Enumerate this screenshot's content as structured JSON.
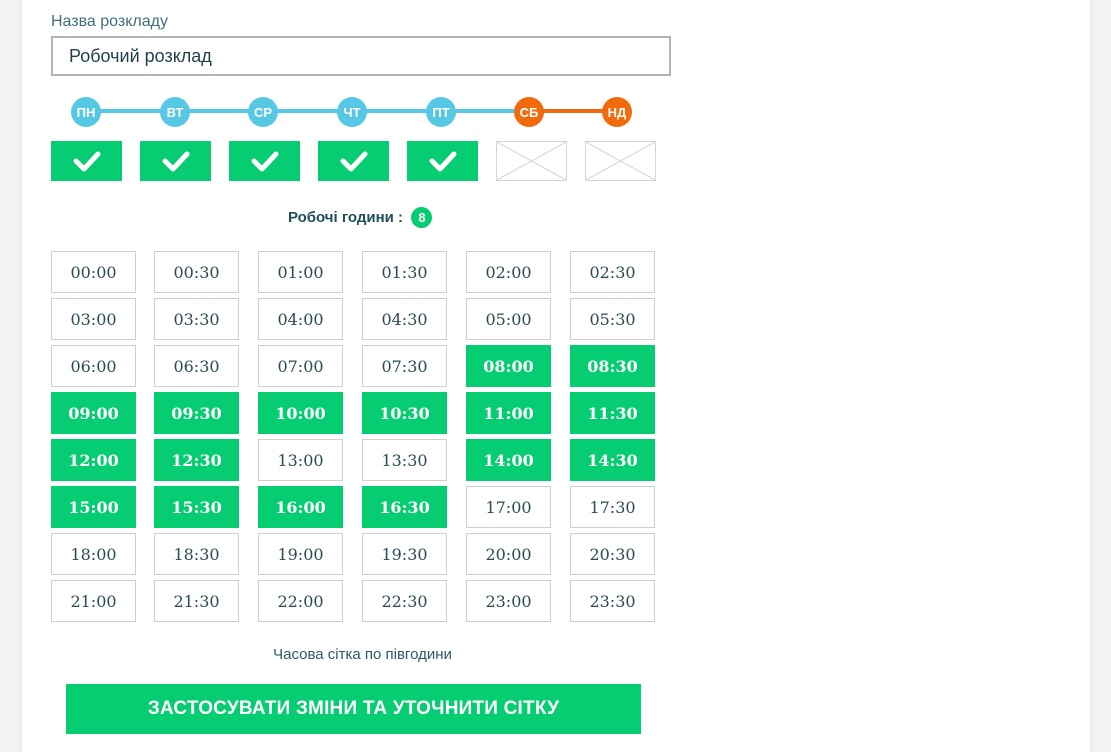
{
  "form": {
    "name_label": "Назва розкладу",
    "name_value": "Робочий розклад"
  },
  "colors": {
    "weekday": "#56c8e3",
    "weekend": "#f26a0e",
    "active": "#06cd72"
  },
  "days": [
    {
      "label": "ПН",
      "active": true,
      "weekend": false
    },
    {
      "label": "ВТ",
      "active": true,
      "weekend": false
    },
    {
      "label": "СР",
      "active": true,
      "weekend": false
    },
    {
      "label": "ЧТ",
      "active": true,
      "weekend": false
    },
    {
      "label": "ПТ",
      "active": true,
      "weekend": false
    },
    {
      "label": "СБ",
      "active": false,
      "weekend": true
    },
    {
      "label": "НД",
      "active": false,
      "weekend": true
    }
  ],
  "working_hours": {
    "label": "Робочі години :",
    "count": "8"
  },
  "time_slots": [
    {
      "time": "00:00",
      "active": false
    },
    {
      "time": "00:30",
      "active": false
    },
    {
      "time": "01:00",
      "active": false
    },
    {
      "time": "01:30",
      "active": false
    },
    {
      "time": "02:00",
      "active": false
    },
    {
      "time": "02:30",
      "active": false
    },
    {
      "time": "03:00",
      "active": false
    },
    {
      "time": "03:30",
      "active": false
    },
    {
      "time": "04:00",
      "active": false
    },
    {
      "time": "04:30",
      "active": false
    },
    {
      "time": "05:00",
      "active": false
    },
    {
      "time": "05:30",
      "active": false
    },
    {
      "time": "06:00",
      "active": false
    },
    {
      "time": "06:30",
      "active": false
    },
    {
      "time": "07:00",
      "active": false
    },
    {
      "time": "07:30",
      "active": false
    },
    {
      "time": "08:00",
      "active": true
    },
    {
      "time": "08:30",
      "active": true
    },
    {
      "time": "09:00",
      "active": true
    },
    {
      "time": "09:30",
      "active": true
    },
    {
      "time": "10:00",
      "active": true
    },
    {
      "time": "10:30",
      "active": true
    },
    {
      "time": "11:00",
      "active": true
    },
    {
      "time": "11:30",
      "active": true
    },
    {
      "time": "12:00",
      "active": true
    },
    {
      "time": "12:30",
      "active": true
    },
    {
      "time": "13:00",
      "active": false
    },
    {
      "time": "13:30",
      "active": false
    },
    {
      "time": "14:00",
      "active": true
    },
    {
      "time": "14:30",
      "active": true
    },
    {
      "time": "15:00",
      "active": true
    },
    {
      "time": "15:30",
      "active": true
    },
    {
      "time": "16:00",
      "active": true
    },
    {
      "time": "16:30",
      "active": true
    },
    {
      "time": "17:00",
      "active": false
    },
    {
      "time": "17:30",
      "active": false
    },
    {
      "time": "18:00",
      "active": false
    },
    {
      "time": "18:30",
      "active": false
    },
    {
      "time": "19:00",
      "active": false
    },
    {
      "time": "19:30",
      "active": false
    },
    {
      "time": "20:00",
      "active": false
    },
    {
      "time": "20:30",
      "active": false
    },
    {
      "time": "21:00",
      "active": false
    },
    {
      "time": "21:30",
      "active": false
    },
    {
      "time": "22:00",
      "active": false
    },
    {
      "time": "22:30",
      "active": false
    },
    {
      "time": "23:00",
      "active": false
    },
    {
      "time": "23:30",
      "active": false
    }
  ],
  "grid_note": "Часова сітка по півгодини",
  "apply_button": "ЗАСТОСУВАТИ ЗМІНИ ТА УТОЧНИТИ СІТКУ"
}
